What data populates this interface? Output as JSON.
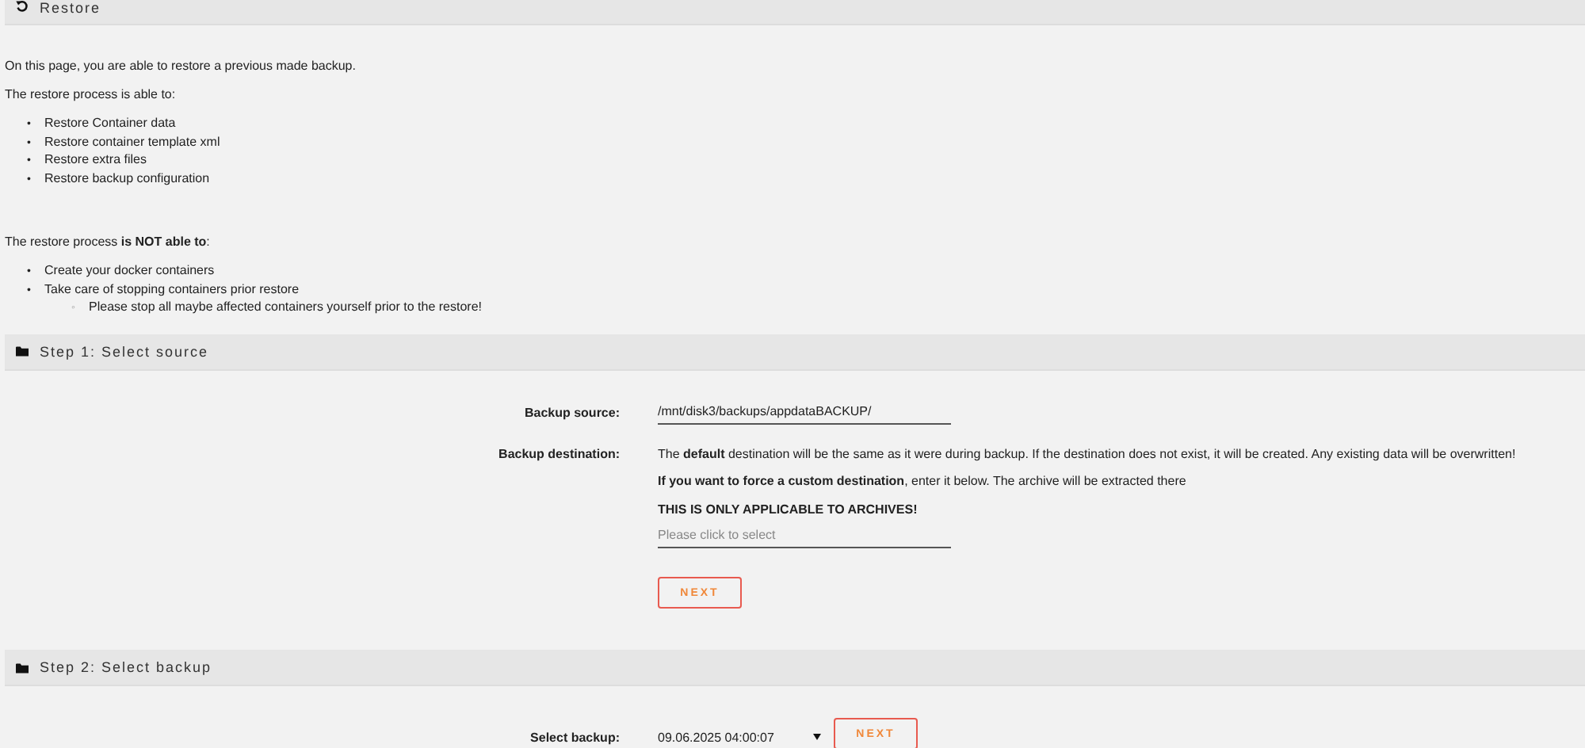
{
  "header": {
    "title": "Restore"
  },
  "intro": "On this page, you are able to restore a previous made backup.",
  "able_heading": "The restore process is able to:",
  "able_list": [
    {
      "marker": "•",
      "text": "Restore Container data"
    },
    {
      "marker": "•",
      "text": "Restore container template xml"
    },
    {
      "marker": "•",
      "text": "Restore extra files"
    },
    {
      "marker": "•",
      "text": "Restore backup configuration"
    }
  ],
  "not_able_heading": "The restore process **is NOT able to**:",
  "not_able_list": [
    {
      "marker": "•",
      "text": "Create your docker containers"
    },
    {
      "marker": "•",
      "text": "Take care of stopping containers prior restore",
      "children": [
        {
          "marker": "◦",
          "text": "Please stop all maybe affected containers yourself prior to the restore!"
        }
      ]
    }
  ],
  "step1": {
    "title": "Step 1: Select source",
    "source_label": "Backup source:",
    "source_value": "/mnt/disk3/backups/appdataBACKUP/",
    "destination_label": "Backup destination:",
    "destination_notes": [
      "The **default** destination will be the same as it were during backup. If the destination does not exist, it will be created. Any existing data will be overwritten!",
      "**If you want to force a custom destination**, enter it below. The archive will be extracted there",
      "**THIS IS ONLY APPLICABLE TO ARCHIVES!**"
    ],
    "destination_placeholder": "Please click to select",
    "next_button": "NEXT"
  },
  "step2": {
    "title": "Step 2: Select backup",
    "select_label": "Select backup:",
    "select_value": "09.06.2025 04:00:07",
    "next_button": "NEXT"
  }
}
